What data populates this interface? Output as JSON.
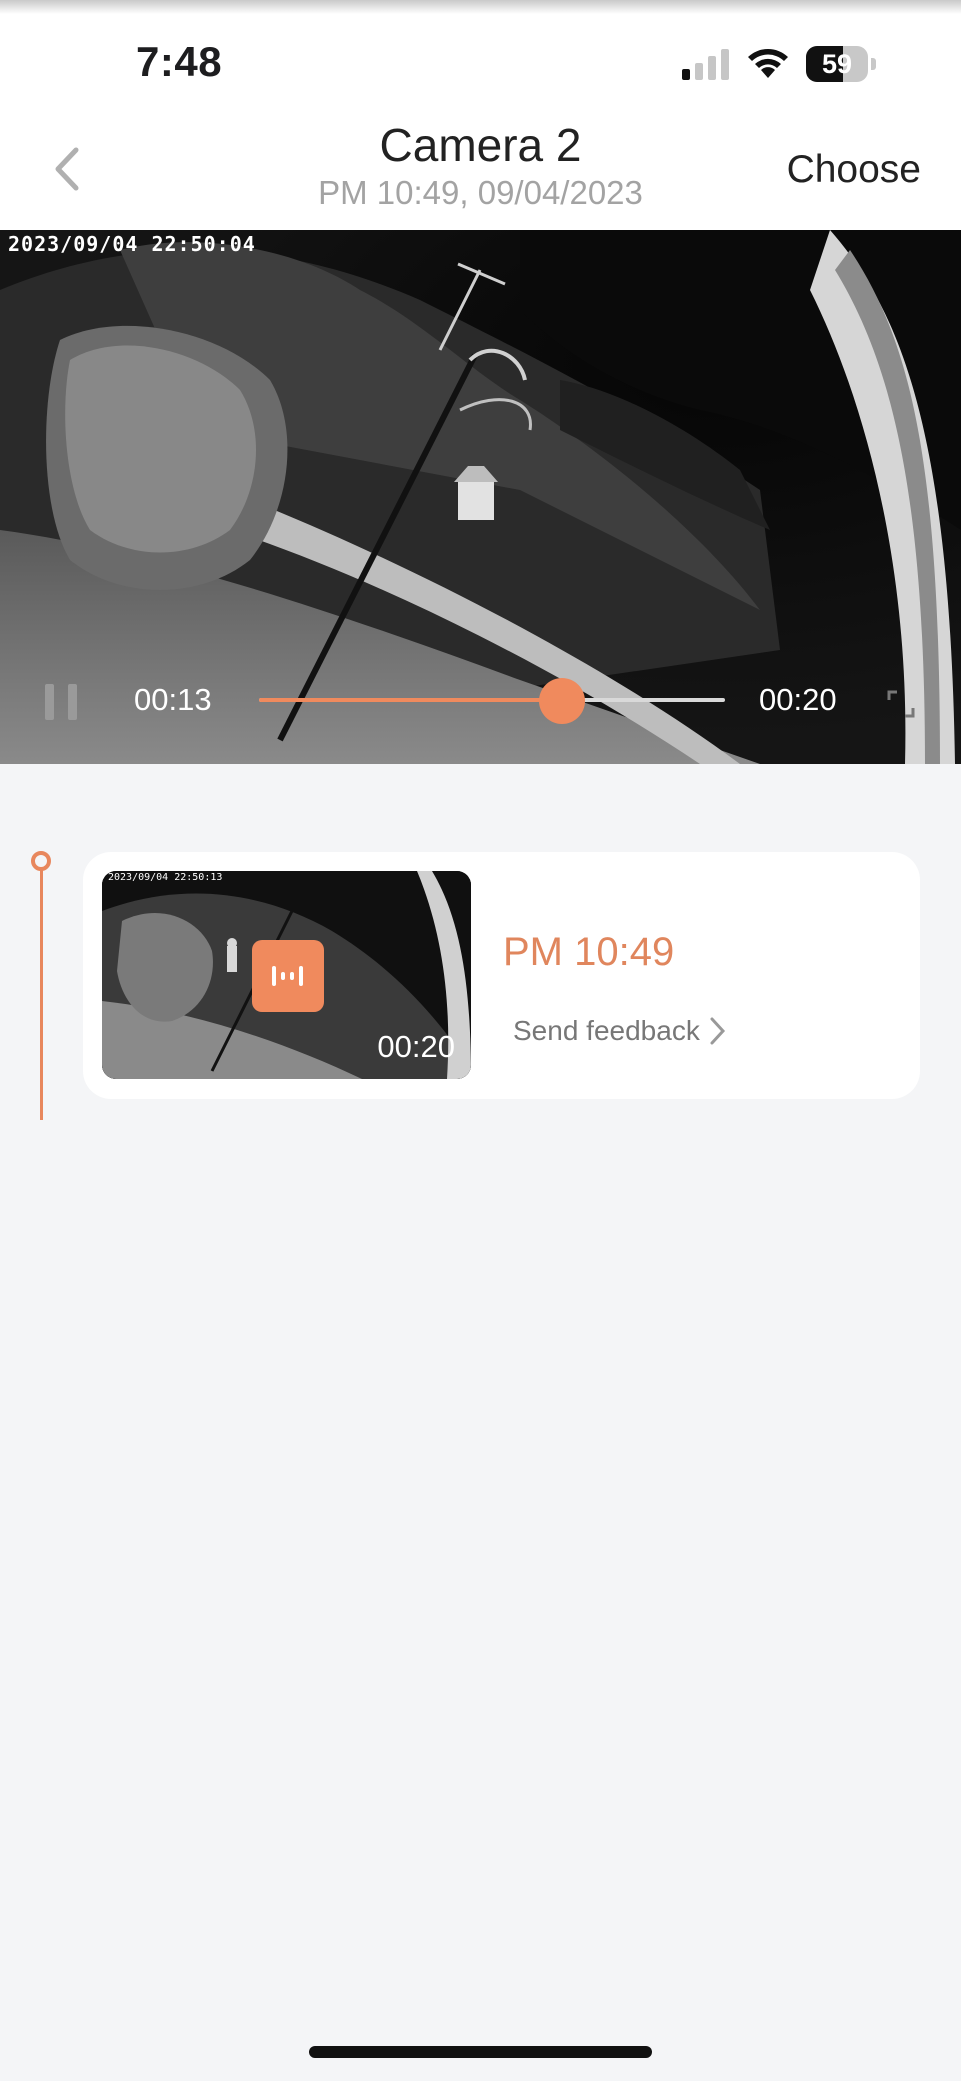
{
  "status_bar": {
    "time": "7:48",
    "battery_level": "59",
    "battery_fraction": 0.59,
    "signal_bars_active": 1,
    "signal_bars_total": 4
  },
  "header": {
    "title": "Camera 2",
    "subtitle": "PM 10:49, 09/04/2023",
    "choose_label": "Choose",
    "back_icon": "chevron-left-icon"
  },
  "player": {
    "osd_timestamp": "2023/09/04 22:50:04",
    "current_time": "00:13",
    "total_time": "00:20",
    "progress_fraction": 0.65,
    "accent_color": "#f08a5d",
    "pause_icon": "pause-icon",
    "fullscreen_icon": "fullscreen-icon"
  },
  "events": [
    {
      "thumb_osd": "2023/09/04 22:50:13",
      "duration": "00:20",
      "badge_icon": "motion-icon",
      "time_label": "PM 10:49",
      "feedback_label": "Send feedback"
    }
  ],
  "colors": {
    "accent": "#f08a5d",
    "time_label": "#e0865d",
    "background": "#f4f5f7"
  }
}
